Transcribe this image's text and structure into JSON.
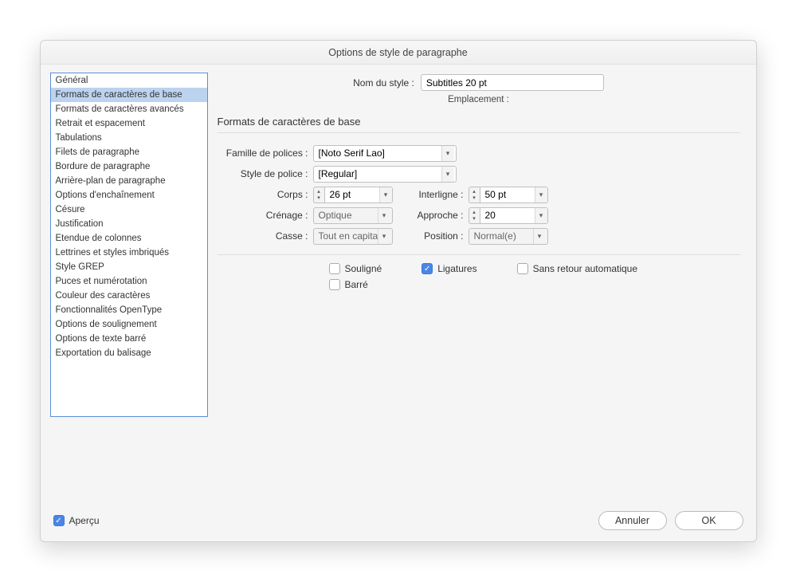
{
  "title": "Options de style de paragraphe",
  "sidebar": {
    "items": [
      "Général",
      "Formats de caractères de base",
      "Formats de caractères avancés",
      "Retrait et espacement",
      "Tabulations",
      "Filets de paragraphe",
      "Bordure de paragraphe",
      "Arrière-plan de paragraphe",
      "Options d'enchaînement",
      "Césure",
      "Justification",
      "Etendue de colonnes",
      "Lettrines et styles imbriqués",
      "Style GREP",
      "Puces et numérotation",
      "Couleur des caractères",
      "Fonctionnalités OpenType",
      "Options de soulignement",
      "Options de texte barré",
      "Exportation du balisage"
    ],
    "selected_index": 1
  },
  "header": {
    "name_label": "Nom du style :",
    "name_value": "Subtitles 20 pt",
    "location_label": "Emplacement :"
  },
  "section_title": "Formats de caractères de base",
  "form": {
    "family_label": "Famille de polices :",
    "family_value": "[Noto Serif Lao]",
    "style_label": "Style de police :",
    "style_value": "[Regular]",
    "size_label": "Corps :",
    "size_value": "26 pt",
    "leading_label": "Interligne :",
    "leading_value": "50 pt",
    "kerning_label": "Crénage :",
    "kerning_value": "Optique",
    "tracking_label": "Approche :",
    "tracking_value": "20",
    "case_label": "Casse :",
    "case_value": "Tout en capita...",
    "position_label": "Position :",
    "position_value": "Normal(e)"
  },
  "checks": {
    "underline": "Souligné",
    "ligatures": "Ligatures",
    "nobreak": "Sans retour automatique",
    "strike": "Barré"
  },
  "footer": {
    "preview": "Aperçu",
    "cancel": "Annuler",
    "ok": "OK"
  }
}
